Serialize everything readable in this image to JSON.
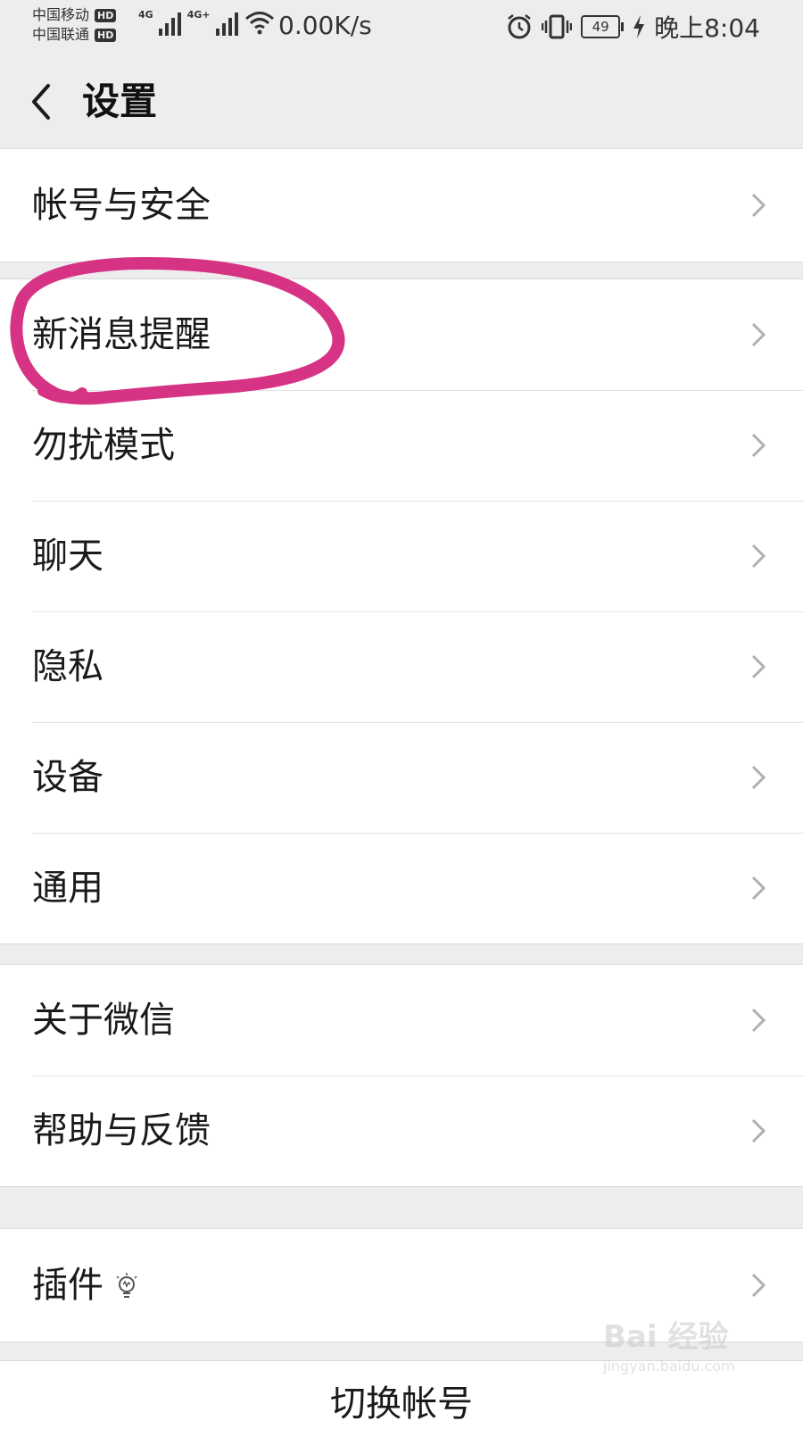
{
  "status_bar": {
    "carrier1": "中国移动",
    "carrier2": "中国联通",
    "hd": "HD",
    "network1": "4G",
    "network2": "4G+",
    "speed": "0.00K/s",
    "battery": "49",
    "time": "晚上8:04",
    "icons": [
      "signal-icon",
      "wifi-icon",
      "alarm-icon",
      "vibrate-icon",
      "battery-icon",
      "charging-icon"
    ]
  },
  "header": {
    "title": "设置"
  },
  "groups": [
    {
      "items": [
        {
          "label": "帐号与安全"
        }
      ]
    },
    {
      "items": [
        {
          "label": "新消息提醒"
        },
        {
          "label": "勿扰模式"
        },
        {
          "label": "聊天"
        },
        {
          "label": "隐私"
        },
        {
          "label": "设备"
        },
        {
          "label": "通用"
        }
      ]
    },
    {
      "items": [
        {
          "label": "关于微信"
        },
        {
          "label": "帮助与反馈"
        }
      ]
    },
    {
      "items": [
        {
          "label": "插件",
          "icon": "lightbulb-icon"
        }
      ]
    }
  ],
  "footer": {
    "switch_account": "切换帐号"
  },
  "watermark": {
    "brand": "Bai 经验",
    "url": "jingyan.baidu.com"
  },
  "colors": {
    "background": "#ededf0",
    "annotation": "#d63384"
  }
}
